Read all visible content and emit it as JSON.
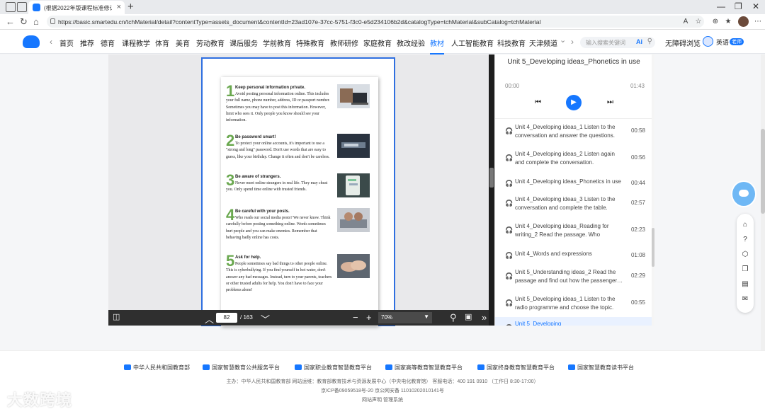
{
  "browser": {
    "tab_title": "(根据2022年版课程标准修订）",
    "url": "https://basic.smartedu.cn/tchMaterial/detail?contentType=assets_document&contentId=23ad107e-37cc-5751-f3c0-e5d234106b2d&catalogType=tchMaterial&subCatalog=tchMaterial"
  },
  "site_nav": {
    "items": [
      "首页",
      "推荐",
      "德育",
      "课程教学",
      "体育",
      "美育",
      "劳动教育",
      "课后服务",
      "学前教育",
      "特殊教育",
      "教师研修",
      "家庭教育",
      "教改经验",
      "教材",
      "人工智能教育",
      "科技教育",
      "天津频道"
    ],
    "active": "教材",
    "search_placeholder": "输入搜索关键词",
    "search_ai": "Ai",
    "accessibility": "无障碍浏览",
    "user_name": "英语",
    "user_badge": "老师"
  },
  "pdf": {
    "page_current": "82",
    "page_total": "/ 163",
    "zoom": "70%",
    "tips": [
      {
        "num": "1",
        "head": "Keep personal information private.",
        "body": "Avoid posting personal information online. This includes your full name, phone number, address, ID or passport number. Sometimes you may have to post this information. However, limit who sees it. Only people you know should see your information."
      },
      {
        "num": "2",
        "head": "Be password smart!",
        "body": "To protect your online accounts, it's important to use a \"strong and long\" password. Don't use words that are easy to guess, like your birthday. Change it often and don't be careless."
      },
      {
        "num": "3",
        "head": "Be aware of strangers.",
        "body": "Never meet online strangers in real life. They may cheat you. Only spend time online with trusted friends."
      },
      {
        "num": "4",
        "head": "Be careful with your posts.",
        "body": "Who reads our social media posts? We never know. Think carefully before posting something online. Words sometimes hurt people and you can make enemies. Remember that behaving badly online has costs."
      },
      {
        "num": "5",
        "head": "Ask for help.",
        "body": "People sometimes say bad things to other people online. This is cyberbullying. If you find yourself in hot water, don't answer any bad messages. Instead, turn to your parents, teachers or other trusted adults for help. You don't have to face your problems alone!"
      }
    ]
  },
  "player": {
    "title": "Unit 5_Developing ideas_Phonetics in use",
    "time_current": "00:00",
    "time_total": "01:43",
    "tracks": [
      {
        "name": "Unit 4_Developing ideas_1 Listen to the conversation and answer the questions.",
        "dur": "00:58"
      },
      {
        "name": "Unit 4_Developing ideas_2 Listen again and complete the conversation.",
        "dur": "00:56"
      },
      {
        "name": "Unit 4_Developing ideas_Phonetics in use",
        "dur": "00:44"
      },
      {
        "name": "Unit 4_Developing ideas_3 Listen to the conversation and complete the table.",
        "dur": "02:57"
      },
      {
        "name": "Unit 4_Developing ideas_Reading for writing_2 Read the passage. Who teache…",
        "dur": "02:23"
      },
      {
        "name": "Unit 4_Words and expressions",
        "dur": "01:08"
      },
      {
        "name": "Unit 5_Understanding ideas_2 Read the passage and find out how the passenger…",
        "dur": "02:29"
      },
      {
        "name": "Unit 5_Developing ideas_1 Listen to the radio programme and choose the topic.",
        "dur": "00:55"
      },
      {
        "name": "Unit 5_Developing",
        "dur": ""
      }
    ]
  },
  "footer": {
    "partners": [
      "中华人民共和国教育部",
      "国家智慧教育公共服务平台",
      "国家职业教育智慧教育平台",
      "国家高等教育智慧教育平台",
      "国家终身教育智慧教育平台",
      "国家智慧教育读书平台"
    ],
    "line1": "主办：中华人民共和国教育部    网站运维：教育部教育技术与资源发展中心（中央电化教育馆）    客服电话：400 191 0910 （工作日 8:30-17:00）",
    "line2": "京ICP备09059518号-20    京公网安备 11010202010141号",
    "line3": "网站声明    管理系统"
  },
  "watermark": "大数跨境",
  "colors": {
    "accent": "#1677ff",
    "pdf_frame": "#2f6fe0",
    "toolbar": "#2f2f2f"
  }
}
